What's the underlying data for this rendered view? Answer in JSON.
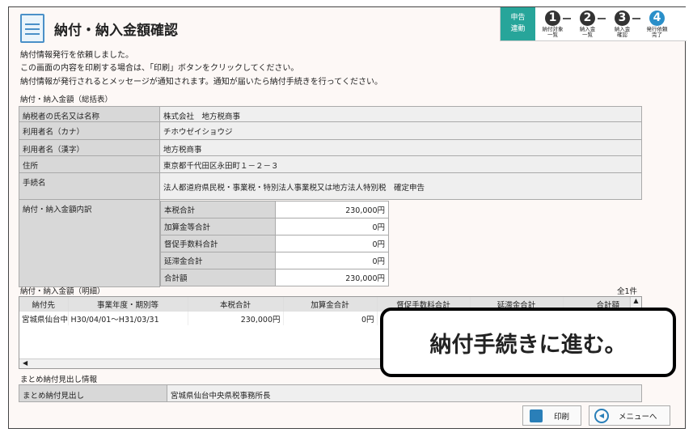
{
  "header": {
    "title": "納付・納入金額確認"
  },
  "stepper": {
    "badge": "申告\n連動",
    "steps": [
      {
        "num": "1",
        "label": "納付対象\n一覧"
      },
      {
        "num": "2",
        "label": "納入金\n一覧"
      },
      {
        "num": "3",
        "label": "納入金\n確認"
      },
      {
        "num": "4",
        "label": "発行依頼\n完了",
        "active": true
      }
    ]
  },
  "messages": [
    "納付情報発行を依頼しました。",
    "この画面の内容を印刷する場合は、「印刷」ボタンをクリックしてください。",
    "納付情報が発行されるとメッセージが通知されます。通知が届いたら納付手続きを行ってください。"
  ],
  "summary": {
    "label": "納付・納入金額（総括表）",
    "rows": [
      {
        "k": "納税者の氏名又は名称",
        "v": "株式会社　地方税商事"
      },
      {
        "k": "利用者名（カナ）",
        "v": "チホウゼイショウジ"
      },
      {
        "k": "利用者名（漢字）",
        "v": "地方税商事"
      },
      {
        "k": "住所",
        "v": "東京都千代田区永田町１－２－３"
      },
      {
        "k": "手続名",
        "v": "法人都道府県民税・事業税・特別法人事業税又は地方法人特別税　確定申告"
      }
    ],
    "breakdown_label": "納付・納入金額内訳",
    "breakdown": [
      {
        "k": "本税合計",
        "v": "230,000円"
      },
      {
        "k": "加算金等合計",
        "v": "0円"
      },
      {
        "k": "督促手数料合計",
        "v": "0円"
      },
      {
        "k": "延滞金合計",
        "v": "0円"
      },
      {
        "k": "合計額",
        "v": "230,000円"
      }
    ]
  },
  "detail": {
    "label": "納付・納入金額（明細）",
    "count": "全1件",
    "columns": [
      "納付先",
      "事業年度・期別等",
      "本税合計",
      "加算金合計",
      "督促手数料合計",
      "延滞金合計",
      "合計額"
    ],
    "rows": [
      [
        "宮城県仙台中央県税事務所",
        "H30/04/01～H31/03/31",
        "230,000円",
        "0円",
        "",
        "",
        ""
      ]
    ]
  },
  "matome": {
    "label": "まとめ納付見出し情報",
    "key": "まとめ納付見出し",
    "value": "宮城県仙台中央県税事務所長"
  },
  "buttons": {
    "print": "印刷",
    "menu": "メニューへ"
  },
  "overlay": {
    "text": "納付手続きに進む。"
  }
}
